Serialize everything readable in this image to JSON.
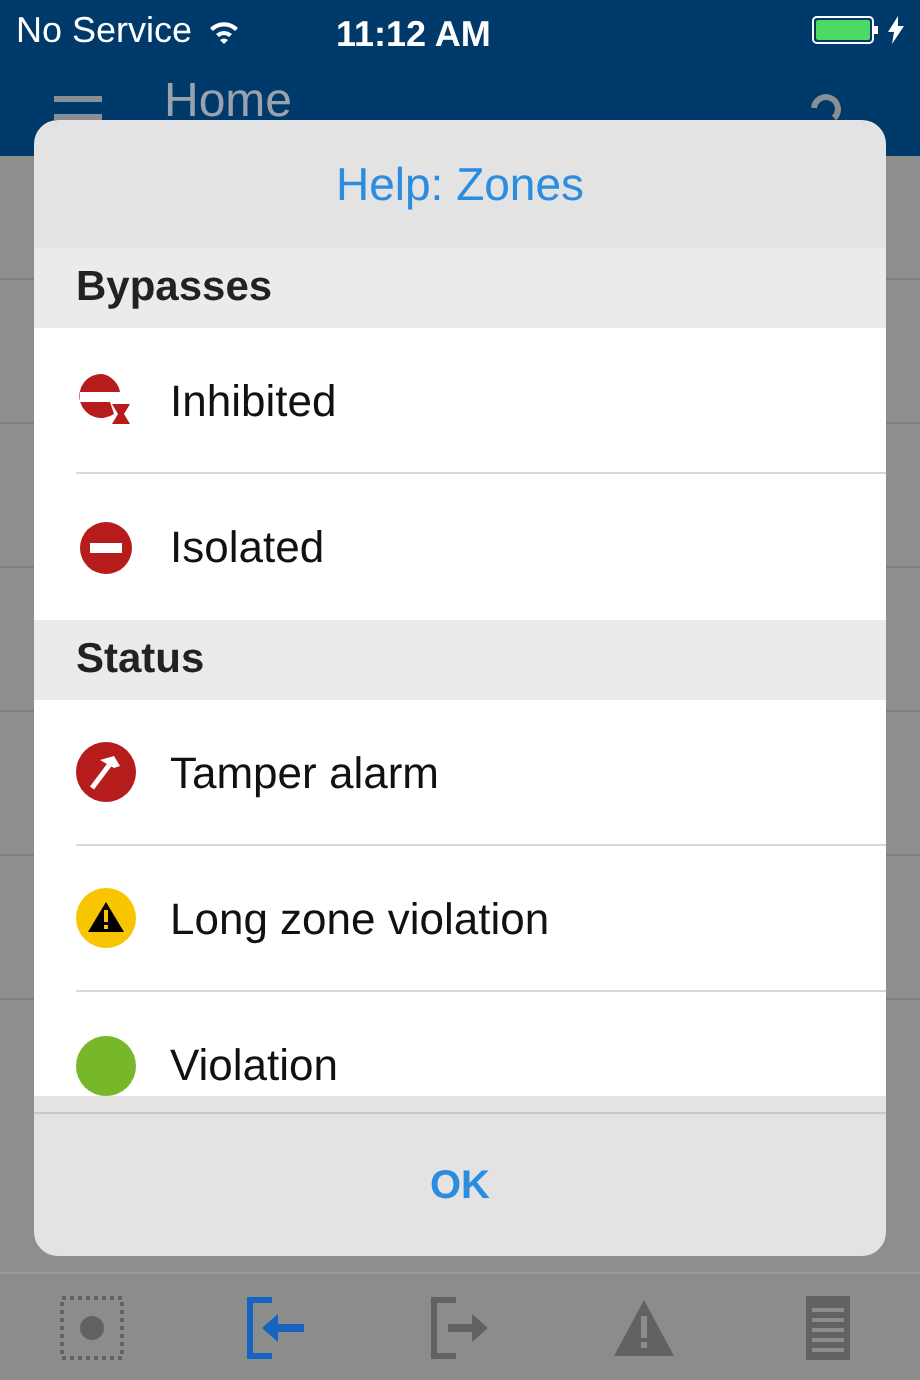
{
  "status_bar": {
    "carrier": "No Service",
    "time": "11:12 AM"
  },
  "nav": {
    "title": "Home"
  },
  "dialog": {
    "title": "Help: Zones",
    "sections": [
      {
        "heading": "Bypasses",
        "items": [
          {
            "label": "Inhibited",
            "kind": "inhibited"
          },
          {
            "label": "Isolated",
            "kind": "isolated"
          }
        ]
      },
      {
        "heading": "Status",
        "items": [
          {
            "label": "Tamper alarm",
            "kind": "tamper"
          },
          {
            "label": "Long zone violation",
            "kind": "long_violation"
          },
          {
            "label": "Violation",
            "kind": "violation"
          }
        ]
      }
    ],
    "button": "OK"
  },
  "tab_bar": [
    {
      "kind": "zones",
      "selected": false
    },
    {
      "kind": "arm_in",
      "selected": true
    },
    {
      "kind": "arm_out",
      "selected": false
    },
    {
      "kind": "alarms",
      "selected": false
    },
    {
      "kind": "log",
      "selected": false
    }
  ]
}
